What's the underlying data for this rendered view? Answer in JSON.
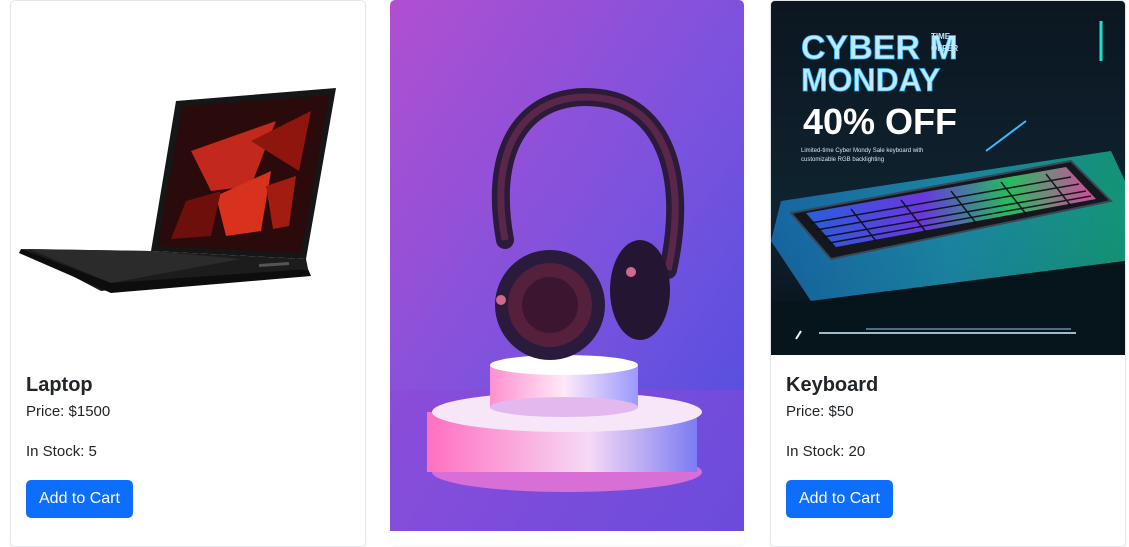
{
  "products": [
    {
      "name": "Laptop",
      "price": "Price: $1500",
      "stock": "In Stock: 5",
      "button_label": "Add to Cart",
      "image": "laptop-image"
    },
    {
      "image": "headphones-image"
    },
    {
      "name": "Keyboard",
      "price": "Price: $50",
      "stock": "In Stock: 20",
      "button_label": "Add to Cart",
      "image": "keyboard-banner-image",
      "banner": {
        "line1": "CYBER M",
        "tag1": "TIME",
        "tag2": "OFFER",
        "line2": "MONDAY",
        "line3": "40% OFF",
        "caption1": "Limited-time Cyber Mondy Sale keyboard with",
        "caption2": "customizable RGB backlighting"
      }
    }
  ],
  "colors": {
    "button": "#0d6efd",
    "text": "#212529",
    "border": "#e3e5e8"
  }
}
